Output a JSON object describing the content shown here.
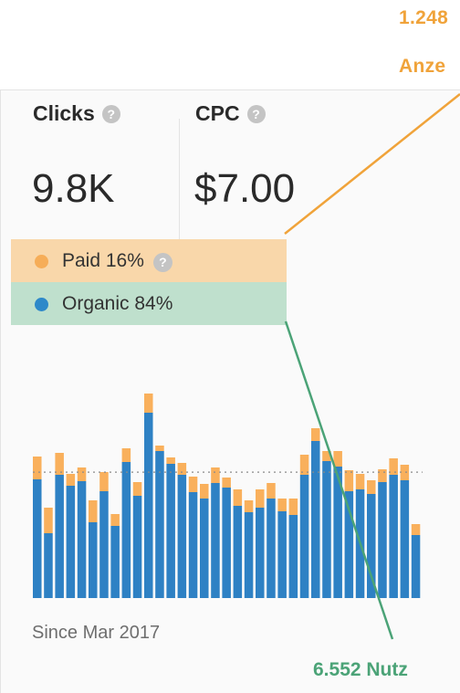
{
  "annotations": {
    "top_line1": "1.248",
    "top_line2": "Anze",
    "bottom": "6.552 Nutz"
  },
  "metrics": [
    {
      "label": "Clicks",
      "value": "9.8K"
    },
    {
      "label": "CPC",
      "value": "$7.00"
    }
  ],
  "legend": [
    {
      "label": "Paid 16%",
      "color": "#f6ad58",
      "band": "#f9d7aa",
      "help": "?"
    },
    {
      "label": "Organic 84%",
      "color": "#2e89c9",
      "band": "#bfe0cd"
    }
  ],
  "footer": "Since Mar 2017",
  "colors": {
    "paid": "#f9b05c",
    "organic": "#2e81c4",
    "annotation_orange": "#f0a33a",
    "annotation_green": "#4ba377",
    "average_line": "#8a8a8a"
  },
  "chart_data": {
    "type": "bar",
    "stacked": true,
    "y_axis_visible": false,
    "reference_line": "dotted average line",
    "series": [
      {
        "name": "Organic",
        "values": [
          130,
          71,
          135,
          123,
          128,
          83,
          117,
          79,
          149,
          112,
          203,
          161,
          147,
          135,
          116,
          109,
          126,
          121,
          101,
          94,
          99,
          109,
          95,
          91,
          135,
          172,
          150,
          144,
          117,
          119,
          114,
          127,
          135,
          129,
          69
        ]
      },
      {
        "name": "Paid",
        "values": [
          25,
          28,
          24,
          13,
          15,
          24,
          21,
          13,
          15,
          15,
          21,
          6,
          7,
          13,
          17,
          16,
          17,
          11,
          18,
          13,
          20,
          17,
          14,
          18,
          22,
          14,
          11,
          17,
          23,
          17,
          15,
          14,
          18,
          17,
          12
        ]
      }
    ]
  }
}
